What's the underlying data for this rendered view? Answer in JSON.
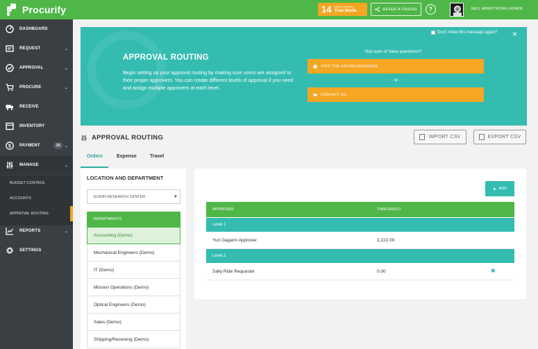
{
  "app": {
    "name": "Procurify"
  },
  "topbar": {
    "trial_days": "14",
    "trial_days_label": "days remaining",
    "trial_mode": "Trial Mode",
    "refer_label": "REFER A FRIEND",
    "help_label": "?",
    "user_name": "NEIL ARMSTRONG ADMIN"
  },
  "sidebar": {
    "items": [
      {
        "label": "DASHBOARD",
        "icon": "dashboard-icon"
      },
      {
        "label": "REQUEST",
        "icon": "request-icon",
        "chevron": "⌄"
      },
      {
        "label": "APPROVAL",
        "icon": "check-circle-icon",
        "chevron": "⌄"
      },
      {
        "label": "PROCURE",
        "icon": "cart-icon",
        "chevron": "⌄"
      },
      {
        "label": "RECEIVE",
        "icon": "truck-icon"
      },
      {
        "label": "INVENTORY",
        "icon": "inventory-icon"
      },
      {
        "label": "PAYMENT",
        "icon": "dollar-icon",
        "badge": "25",
        "chevron": "⌄"
      },
      {
        "label": "MANAGE",
        "icon": "sliders-icon",
        "chevron": "⌄"
      },
      {
        "label": "REPORTS",
        "icon": "chart-icon",
        "chevron": "⌄"
      },
      {
        "label": "SETTINGS",
        "icon": "gear-icon"
      }
    ],
    "sub_items": [
      {
        "label": "BUDGET CONTROL"
      },
      {
        "label": "ACCOUNTS"
      },
      {
        "label": "APPROVAL ROUTING"
      }
    ]
  },
  "banner": {
    "dont_show": "Don't show this message again?",
    "title": "APPROVAL ROUTING",
    "text": "Begin setting up your approval routing by making sure users are assigned to their proper approvers. You can create different levels of approval if you need and assign multiple approvers at each level.",
    "not_sure": "Not sure or have questions?",
    "kb_button": "VISIT THE KNOWLEDGEBASE",
    "or": "- or -",
    "contact_button": "CONTACT US",
    "close": "×"
  },
  "section": {
    "title": "APPROVAL ROUTING",
    "import_label": "IMPORT CSV",
    "export_label": "EXPORT CSV"
  },
  "tabs": [
    {
      "label": "Orders"
    },
    {
      "label": "Expense"
    },
    {
      "label": "Travel"
    }
  ],
  "location": {
    "title": "LOCATION AND DEPARTMENT",
    "selected_location": "GLENN RESEARCH CENTER",
    "departments_header": "DEPARTMENTS",
    "departments": [
      "Accounting (Demo)",
      "Mechanical Engineers (Demo)",
      "IT (Demo)",
      "Mission Operations (Demo)",
      "Optical Engineers (Demo)",
      "Sales (Demo)",
      "Shipping/Receiving (Demo)"
    ]
  },
  "routing": {
    "add_label": "ADD",
    "headers": {
      "approver": "APPROVER",
      "threshold": "THRESHOLD"
    },
    "levels": [
      {
        "label": "Level 1",
        "approver": "Yuri Gagarin Approver",
        "threshold": "2,222.00"
      },
      {
        "label": "Level 2",
        "approver": "Sally Ride Requester",
        "threshold": "0.00",
        "remove": "✖"
      }
    ]
  },
  "colors": {
    "green": "#4fb748",
    "teal": "#34bcb1",
    "orange": "#f5a623",
    "sidebar": "#3a3f44"
  }
}
